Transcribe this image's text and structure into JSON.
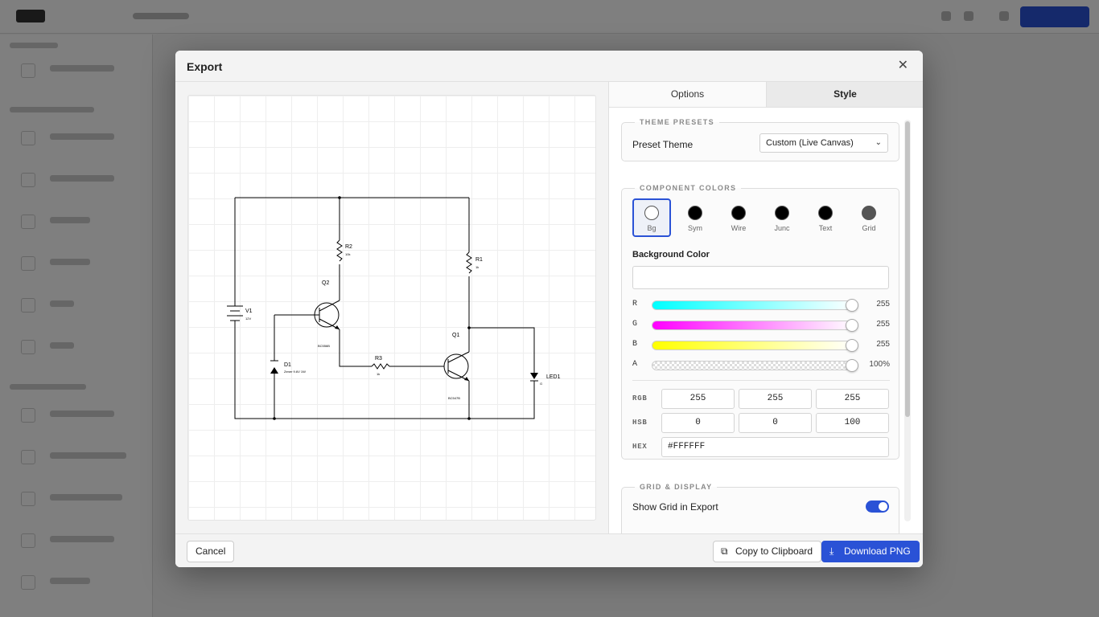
{
  "modal": {
    "title": "Export",
    "close_glyph": "✕"
  },
  "tabs": [
    {
      "label": "Options",
      "active": false
    },
    {
      "label": "Style",
      "active": true
    }
  ],
  "theme_presets": {
    "legend": "THEME PRESETS",
    "preset_label": "Preset Theme",
    "preset_value": "Custom (Live Canvas)"
  },
  "component_colors": {
    "legend": "COMPONENT COLORS",
    "swatches": [
      {
        "label": "Bg",
        "color": "#FFFFFF",
        "selected": true
      },
      {
        "label": "Sym",
        "color": "#000000",
        "selected": false
      },
      {
        "label": "Wire",
        "color": "#000000",
        "selected": false
      },
      {
        "label": "Junc",
        "color": "#000000",
        "selected": false
      },
      {
        "label": "Text",
        "color": "#000000",
        "selected": false
      },
      {
        "label": "Grid",
        "color": "#555555",
        "selected": false
      }
    ],
    "editing_label": "Background Color",
    "sliders": {
      "r": {
        "label": "R",
        "value": "255",
        "fraction": 1.0
      },
      "g": {
        "label": "G",
        "value": "255",
        "fraction": 1.0
      },
      "b": {
        "label": "B",
        "value": "255",
        "fraction": 1.0
      },
      "a": {
        "label": "A",
        "value": "100%",
        "fraction": 1.0
      }
    },
    "rgb": {
      "label": "RGB",
      "values": [
        "255",
        "255",
        "255"
      ]
    },
    "hsb": {
      "label": "HSB",
      "values": [
        "0",
        "0",
        "100"
      ]
    },
    "hex": {
      "label": "HEX",
      "value": "#FFFFFF"
    }
  },
  "grid_display": {
    "legend": "GRID & DISPLAY",
    "show_grid_label": "Show Grid in Export",
    "show_grid": true
  },
  "footer": {
    "cancel": "Cancel",
    "copy": "Copy to Clipboard",
    "download": "Download PNG"
  },
  "circuit": {
    "V1": {
      "name": "V1",
      "value": "12V"
    },
    "R2": {
      "name": "R2",
      "value": "10k"
    },
    "R1": {
      "name": "R1",
      "value": "1k"
    },
    "Q2": {
      "name": "Q2",
      "value": "BC556B"
    },
    "Q1": {
      "name": "Q1",
      "value": "BC547B"
    },
    "R3": {
      "name": "R3",
      "value": "1k"
    },
    "D1": {
      "name": "D1",
      "value": "Zener 9.6V 1W"
    },
    "LED1": {
      "name": "LED1",
      "value": "G"
    }
  },
  "colors": {
    "accent": "#2a52d6",
    "wire": "#000000"
  }
}
